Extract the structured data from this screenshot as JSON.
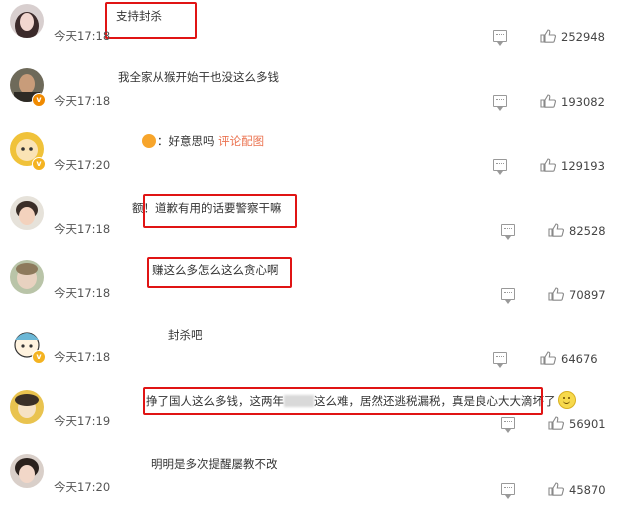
{
  "comments": [
    {
      "time": "今天17:18",
      "text": "支持封杀",
      "likes": "252948"
    },
    {
      "time": "今天17:18",
      "text": "我全家从猴开始干也没这么多钱",
      "likes": "193082"
    },
    {
      "time": "今天17:20",
      "text": "：好意思吗",
      "link": "评论配图",
      "likes": "129193"
    },
    {
      "time": "今天17:18",
      "prefix": "额！",
      "text": "道歉有用的话要警察干嘛",
      "likes": "82528"
    },
    {
      "time": "今天17:18",
      "text": "赚这么多怎么这么贪心啊",
      "likes": "70897"
    },
    {
      "time": "今天17:18",
      "text": "封杀吧",
      "likes": "64676"
    },
    {
      "time": "今天17:19",
      "text_a": "挣了国人这么多钱，这两年",
      "text_b": "这么难，居然还逃税漏税，真是良心大大滴",
      "text_c": "坏了",
      "likes": "56901"
    },
    {
      "time": "今天17:20",
      "text": "明明是多次提醒屡教不改",
      "likes": "45870"
    }
  ],
  "colors": {
    "highlight_box": "#e01414",
    "link": "#eb7350",
    "badge_orange": "#f08a00",
    "badge_gold": "#f4b321"
  },
  "icons": {
    "reply": "comment-icon",
    "like": "thumbs-up-icon"
  }
}
